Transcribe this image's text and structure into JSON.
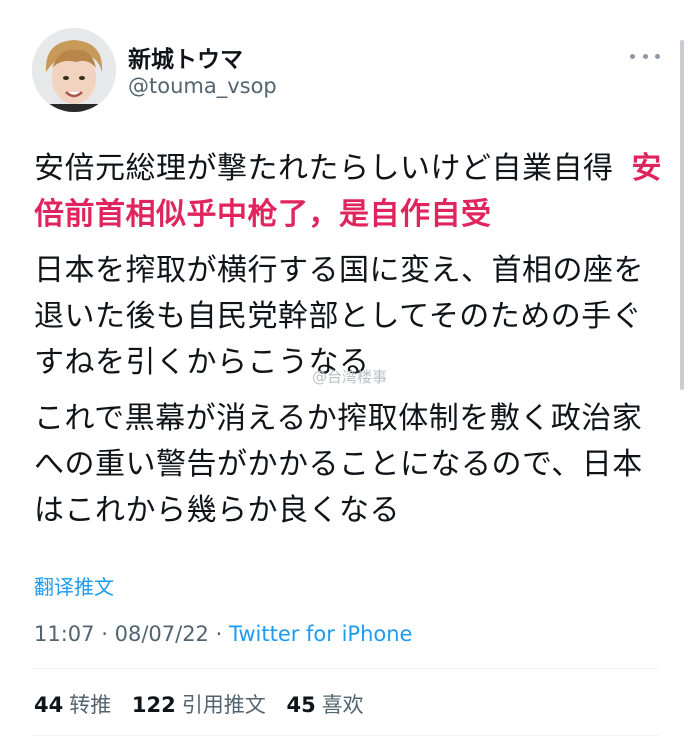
{
  "user": {
    "display_name": "新城トウマ",
    "handle": "@touma_vsop"
  },
  "tweet": {
    "line1": "安倍元総理が撃たれたらしいけど自業自得",
    "translation": "安倍前首相似乎中枪了，是自作自受",
    "paragraph2": "日本を搾取が横行する国に変え、首相の座を退いた後も自民党幹部としてそのための手ぐすねを引くからこうなる",
    "paragraph3": "これで黒幕が消えるか搾取体制を敷く政治家への重い警告がかかることになるので、日本はこれから幾らか良くなる"
  },
  "watermark": "@台湾楼事",
  "translate_label": "翻译推文",
  "meta": {
    "time": "11:07",
    "date": "08/07/22",
    "separator": "·",
    "source": "Twitter for iPhone"
  },
  "stats": {
    "retweets_count": "44",
    "retweets_label": "转推",
    "quotes_count": "122",
    "quotes_label": "引用推文",
    "likes_count": "45",
    "likes_label": "喜欢"
  },
  "colors": {
    "link": "#1d9bf0",
    "translation": "#e0245e",
    "secondary_text": "#536471"
  },
  "icons": [
    "more-options-icon"
  ]
}
